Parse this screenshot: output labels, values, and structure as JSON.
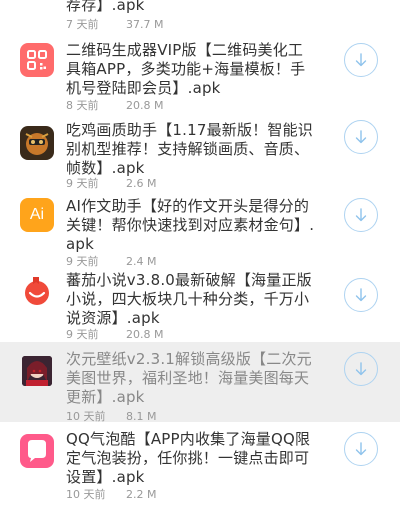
{
  "items": [
    {
      "title": "荐存】.apk",
      "time": "7 天前",
      "size": "37.7 M",
      "icon": "partial-app-icon"
    },
    {
      "title": "二维码生成器VIP版【二维码美化工具箱APP，多类功能+海量模板！手机号登陆即会员】.apk",
      "time": "8 天前",
      "size": "20.8 M",
      "icon": "qr-code-icon",
      "color": "#ff6b6b"
    },
    {
      "title": "吃鸡画质助手【1.17最新版！智能识别机型推荐！支持解锁画质、音质、帧数】.apk",
      "time": "9 天前",
      "size": "2.6 M",
      "icon": "game-character-icon"
    },
    {
      "title": "AI作文助手【好的作文开头是得分的关键！帮你快速找到对应素材金句】.apk",
      "time": "9 天前",
      "size": "2.4 M",
      "icon": "ai-icon",
      "color": "#ffa41b",
      "icon_text": "Ai"
    },
    {
      "title": "蕃茄小说v3.8.0最新破解【海量正版小说，四大板块几十种分类，千万小说资源】.apk",
      "time": "9 天前",
      "size": "20.8 M",
      "icon": "tomato-icon"
    },
    {
      "title": "次元壁纸v2.3.1解锁高级版【二次元美图世界，福利圣地！海量美图每天更新】.apk",
      "time": "10 天前",
      "size": "8.1 M",
      "icon": "anime-girl-icon"
    },
    {
      "title": "QQ气泡酷【APP内收集了海量QQ限定气泡装扮，任你挑！一键点击即可设置】.apk",
      "time": "10 天前",
      "size": "2.2 M",
      "icon": "chat-bubble-icon",
      "color": "#ff5a8a"
    }
  ],
  "download_icon": "download-icon"
}
